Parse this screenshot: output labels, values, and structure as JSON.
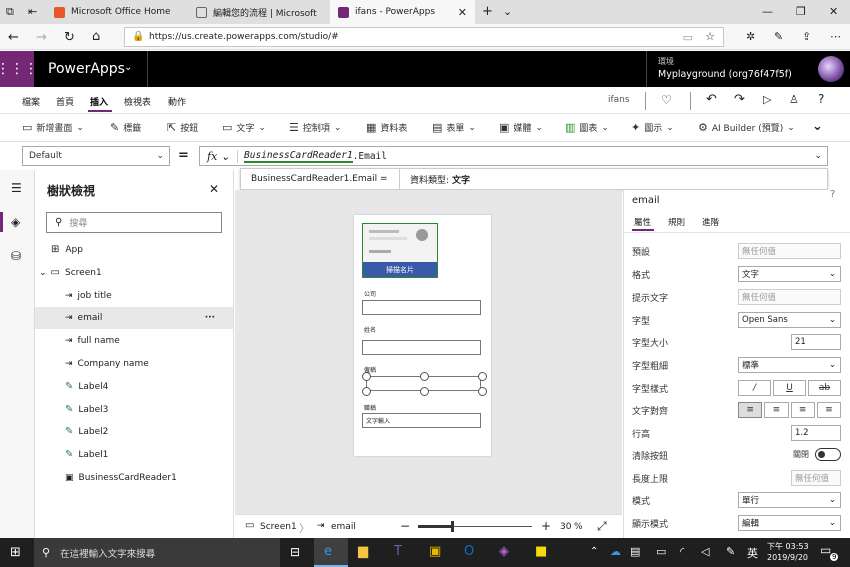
{
  "browser": {
    "tabs": [
      {
        "title": "Microsoft Office Home",
        "fav_color": "#e8562c"
      },
      {
        "title": "編輯您的流程 | Microsoft Flo",
        "fav_color": "#666666"
      },
      {
        "title": "ifans - PowerApps",
        "fav_color": "#742774"
      }
    ],
    "url": "https://us.create.powerapps.com/studio/#"
  },
  "header": {
    "app_name": "PowerApps",
    "env_label": "環境",
    "env_name": "Myplayground (org76f47f5f)"
  },
  "menu": {
    "items": [
      "檔案",
      "首頁",
      "插入",
      "檢視表",
      "動作"
    ],
    "active_index": 2,
    "app_title": "ifans"
  },
  "toolbar": {
    "items": [
      "新增畫面",
      "標籤",
      "按鈕",
      "文字",
      "控制項",
      "資料表",
      "表單",
      "媒體",
      "圖表",
      "圖示",
      "AI Builder (預覽)"
    ]
  },
  "formula": {
    "property": "Default",
    "fx": "fx",
    "ref": "BusinessCardReader1",
    "rest": ".Email",
    "hint_expr": "BusinessCardReader1.Email =",
    "hint_type_label": "資料類型:",
    "hint_type_value": "文字"
  },
  "tree": {
    "title": "樹狀檢視",
    "search_placeholder": "搜尋",
    "app": "App",
    "screen": "Screen1",
    "items": [
      "job title",
      "email",
      "full name",
      "Company name",
      "Label4",
      "Label3",
      "Label2",
      "Label1",
      "BusinessCardReader1"
    ],
    "selected_index": 1,
    "more": "···"
  },
  "canvas": {
    "scan_button": "掃描名片",
    "labels": [
      "公司",
      "姓名",
      "僱稱",
      "職稱"
    ],
    "last_input": "文字輸入"
  },
  "statusbar": {
    "screen": "Screen1",
    "control": "email",
    "zoom": "30",
    "pct": "%",
    "zoom_level": 0.3
  },
  "props": {
    "control": "email",
    "tabs": [
      "屬性",
      "規則",
      "進階"
    ],
    "rows": [
      {
        "label": "預設",
        "value": "無任何值",
        "kind": "ph"
      },
      {
        "label": "格式",
        "value": "文字",
        "kind": "dd"
      },
      {
        "label": "提示文字",
        "value": "無任何值",
        "kind": "ph"
      },
      {
        "label": "字型",
        "value": "Open Sans",
        "kind": "dd"
      },
      {
        "label": "字型大小",
        "value": "21",
        "kind": "box"
      },
      {
        "label": "字型粗細",
        "value": "標準",
        "kind": "dd"
      },
      {
        "label": "字型樣式",
        "value": "",
        "kind": "style"
      },
      {
        "label": "文字對齊",
        "value": "",
        "kind": "align"
      },
      {
        "label": "行高",
        "value": "1.2",
        "kind": "box"
      },
      {
        "label": "清除按鈕",
        "value": "關閉",
        "kind": "toggle"
      },
      {
        "label": "長度上限",
        "value": "無任何值",
        "kind": "ph"
      },
      {
        "label": "模式",
        "value": "單行",
        "kind": "dd"
      },
      {
        "label": "顯示模式",
        "value": "編輯",
        "kind": "dd"
      }
    ]
  },
  "taskbar": {
    "search_placeholder": "在這裡輸入文字來搜尋",
    "ime": "英",
    "time": "下午 03:53",
    "date": "2019/9/20",
    "notif_count": "9"
  },
  "colors": {
    "brand": "#742774",
    "accent": "#0078d4"
  }
}
